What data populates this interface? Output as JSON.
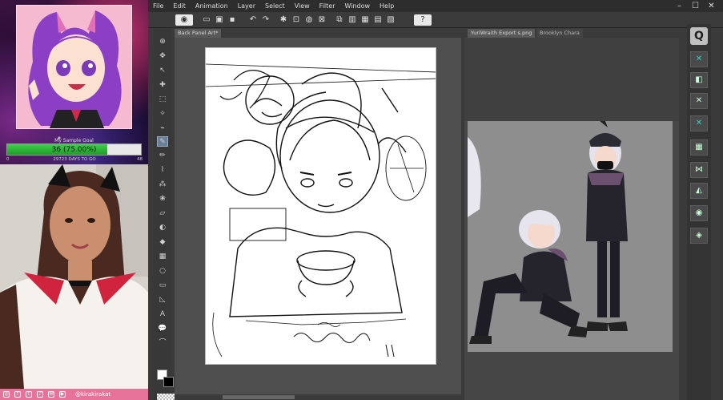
{
  "stream": {
    "goal_title": "My Sample Goal",
    "goal_value": "36 (75.00%)",
    "goal_progress": 0.75,
    "goal_left": "0",
    "goal_days": "29723 DAYS TO GO",
    "goal_right": "48",
    "social_handle": "@kirakirakat",
    "social_icons": [
      "instagram-icon",
      "facebook-icon",
      "twitter-icon",
      "tiktok-icon",
      "mail-icon",
      "youtube-icon"
    ]
  },
  "menu": {
    "items": [
      "File",
      "Edit",
      "Animation",
      "Layer",
      "Select",
      "View",
      "Filter",
      "Window",
      "Help"
    ]
  },
  "window": {
    "minimize": "–",
    "maximize": "☐",
    "close": "✕"
  },
  "tabs": {
    "main": "Back Panel Art*",
    "ref1": "YuriWraith Export s.png",
    "ref2": "Brooklyn Chara"
  },
  "colors": {
    "accent": "#3ad0b0",
    "goal": "#2fb83a",
    "social": "#e8739a"
  }
}
